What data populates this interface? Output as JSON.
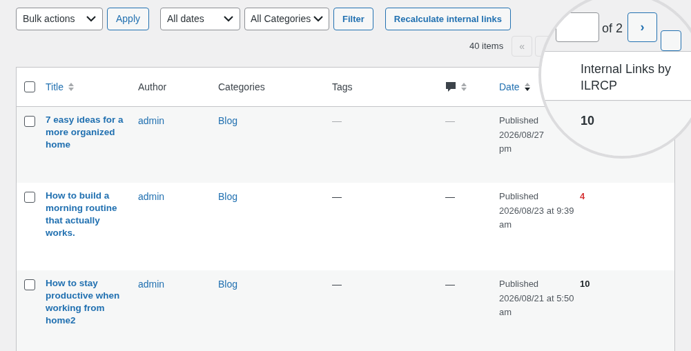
{
  "toolbar": {
    "bulk_actions": "Bulk actions",
    "apply": "Apply",
    "dates": "All dates",
    "categories": "All Categories",
    "filter": "Filter",
    "recalculate": "Recalculate internal links"
  },
  "all_checked": false,
  "pagination": {
    "items": "40 items",
    "first": "«"
  },
  "columns": [
    {
      "label": "Title",
      "kind": "sortable"
    },
    {
      "label": "Author",
      "kind": "plain"
    },
    {
      "label": "Categories",
      "kind": "plain"
    },
    {
      "label": "Tags",
      "kind": "plain"
    },
    {
      "kind": "comments"
    },
    {
      "label": "Date",
      "kind": "sorted"
    }
  ],
  "rows": [
    {
      "title": "7 easy ideas for a more organized home",
      "author": "admin",
      "category": "Blog",
      "tags": "—",
      "comments": "—",
      "status": "Published",
      "date": "2026/08/27",
      "time": "pm",
      "checked": false
    },
    {
      "title": "How to build a morning routine that actually works.",
      "author": "admin",
      "category": "Blog",
      "tags": "—",
      "comments": "—",
      "status": "Published",
      "date": "2026/08/23 at 9:39",
      "time": "am",
      "links": "4",
      "checked": false,
      "warning": true
    },
    {
      "title": "How to stay productive when working from home2",
      "author": "admin",
      "category": "Blog",
      "tags": "—",
      "comments": "—",
      "status": "Published",
      "date": "2026/08/21 at 5:50",
      "time": "am",
      "links": "10",
      "checked": false,
      "warning": false
    }
  ],
  "magnifier": {
    "page_of": "of 2",
    "next": "›",
    "column": "Internal Links by ILRCP",
    "value": "10",
    "value_warning": false
  }
}
